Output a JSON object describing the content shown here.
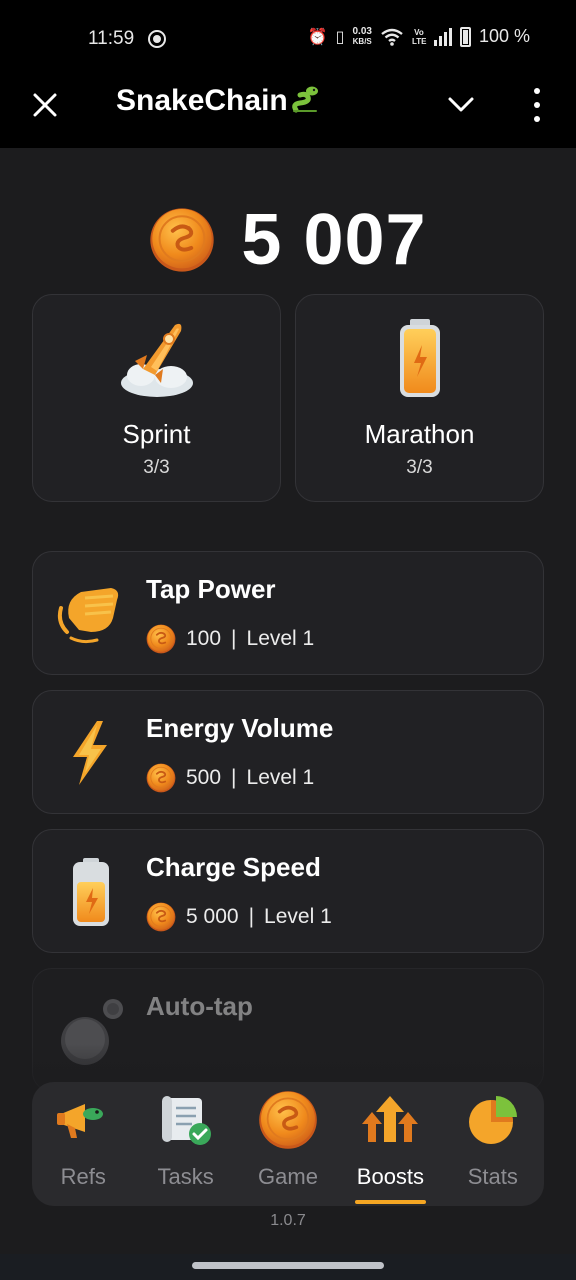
{
  "status_bar": {
    "time": "11:59",
    "net_speed_value": "0.03",
    "net_speed_unit": "KB/S",
    "volte": "Vo LTE",
    "battery": "100 %"
  },
  "app_bar": {
    "title": "SnakeChain",
    "close_icon": "close-icon",
    "collapse_icon": "chevron-down-icon",
    "menu_icon": "more-vertical-icon"
  },
  "balance": {
    "value": "5 007"
  },
  "daily_boosts": [
    {
      "name": "Sprint",
      "count": "3/3",
      "icon": "rocket-icon"
    },
    {
      "name": "Marathon",
      "count": "3/3",
      "icon": "battery-icon"
    }
  ],
  "upgrades": [
    {
      "name": "Tap Power",
      "price": "100",
      "separator": "|",
      "level": "Level 1",
      "icon": "tap-hand-icon"
    },
    {
      "name": "Energy Volume",
      "price": "500",
      "separator": "|",
      "level": "Level 1",
      "icon": "lightning-icon"
    },
    {
      "name": "Charge Speed",
      "price": "5 000",
      "separator": "|",
      "level": "Level 1",
      "icon": "battery-charge-icon"
    },
    {
      "name": "Auto-tap",
      "icon": "auto-tap-coin-icon"
    }
  ],
  "nav": {
    "items": [
      {
        "label": "Refs",
        "icon": "megaphone-icon",
        "active": false
      },
      {
        "label": "Tasks",
        "icon": "scroll-check-icon",
        "active": false
      },
      {
        "label": "Game",
        "icon": "coin-icon",
        "active": false
      },
      {
        "label": "Boosts",
        "icon": "arrows-up-icon",
        "active": true
      },
      {
        "label": "Stats",
        "icon": "pie-chart-icon",
        "active": false
      }
    ]
  },
  "version": "1.0.7",
  "colors": {
    "accent": "#f5a623",
    "background": "#1c1c1e",
    "card": "#212124"
  }
}
